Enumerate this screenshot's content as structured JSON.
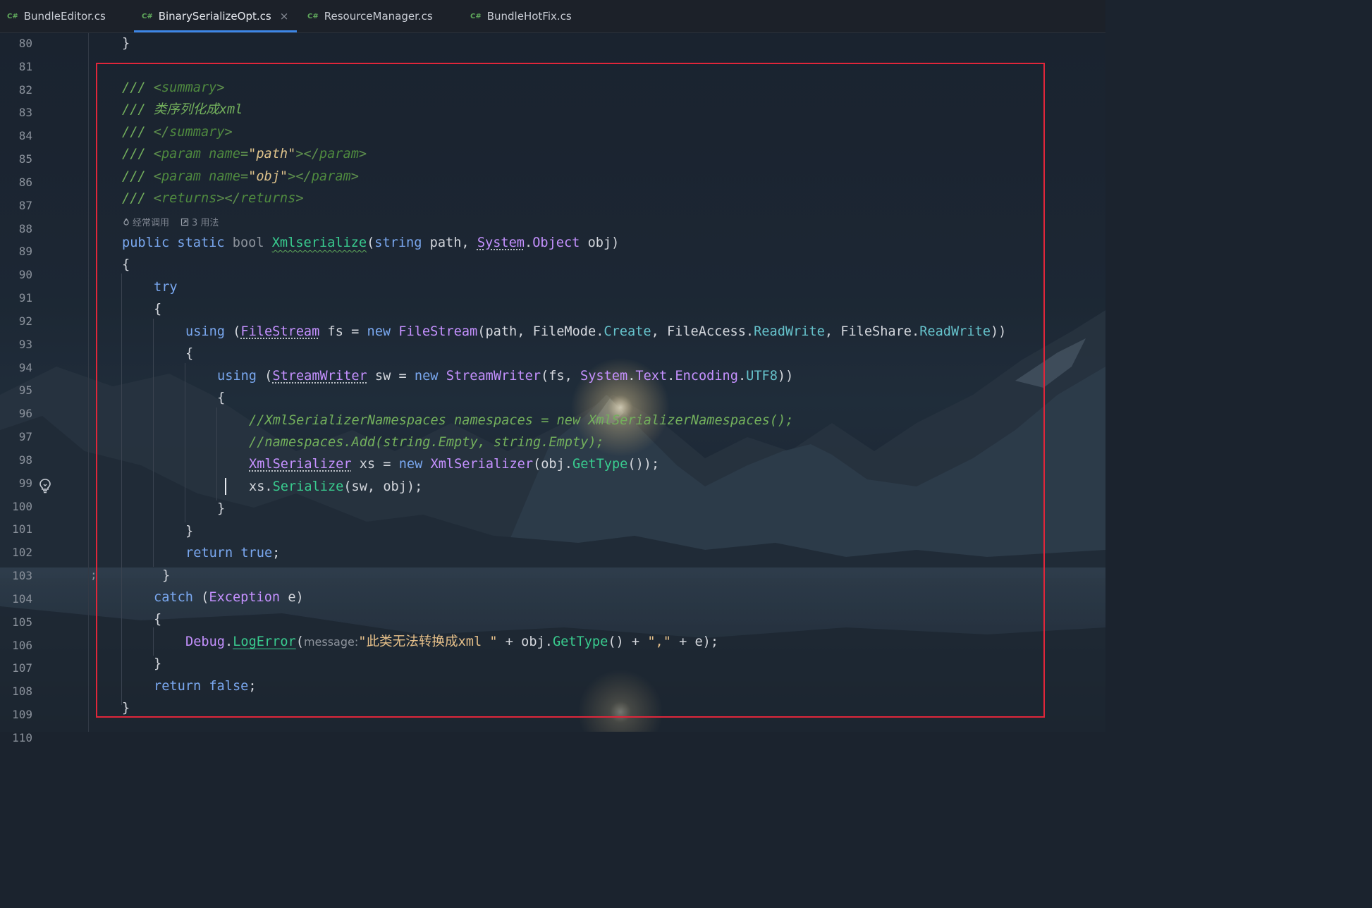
{
  "tabs": [
    {
      "lang": "C#",
      "label": "BundleEditor.cs"
    },
    {
      "lang": "C#",
      "label": "BinarySerializeOpt.cs",
      "close": "×"
    },
    {
      "lang": "C#",
      "label": "ResourceManager.cs"
    },
    {
      "lang": "C#",
      "label": "BundleHotFix.cs"
    }
  ],
  "line_numbers": [
    "80",
    "81",
    "82",
    "83",
    "84",
    "85",
    "86",
    "87",
    "88",
    "89",
    "90",
    "91",
    "92",
    "93",
    "94",
    "95",
    "96",
    "97",
    "98",
    "99",
    "100",
    "101",
    "102",
    "103",
    "104",
    "105",
    "106",
    "107",
    "108",
    "109",
    "110"
  ],
  "codelens": {
    "frequent": "经常调用",
    "usages": "3 用法"
  },
  "code": {
    "l80_brace": "}",
    "l82": {
      "slashes": "/// ",
      "lt": "<",
      "tag": "summary",
      "gt": ">"
    },
    "l83": {
      "slashes": "/// ",
      "text": "类序列化成xml"
    },
    "l84": {
      "slashes": "/// ",
      "lt": "</",
      "tag": "summary",
      "gt": ">"
    },
    "l85": {
      "slashes": "/// ",
      "lt": "<",
      "tag": "param",
      "attr": " name",
      "eq": "=",
      "val": "\"path\"",
      "mid": "></",
      "tag2": "param",
      "gt": ">"
    },
    "l86": {
      "slashes": "/// ",
      "lt": "<",
      "tag": "param",
      "attr": " name",
      "eq": "=",
      "val": "\"obj\"",
      "mid": "></",
      "tag2": "param",
      "gt": ">"
    },
    "l87": {
      "slashes": "/// ",
      "lt": "<",
      "tag": "returns",
      "mid": "></",
      "tag2": "returns",
      "gt": ">"
    },
    "l88": {
      "public": "public",
      "static": "static",
      "bool": "bool",
      "name": "Xmlserialize",
      "open": "(",
      "string": "string",
      "p1": " path, ",
      "system": "System",
      "dot": ".",
      "object": "Object",
      "p2": " obj)"
    },
    "l89": "{",
    "l90": "try",
    "l91": "{",
    "l92": {
      "using": "using",
      "open": " (",
      "fs_type": "FileStream",
      "decl": " fs = ",
      "new": "new",
      "ctor": "FileStream",
      "args1": "(path, ",
      "fm": "FileMode",
      "d1": ".",
      "create": "Create",
      "c1": ", ",
      "fa": "FileAccess",
      "d2": ".",
      "rw1": "ReadWrite",
      "c2": ", ",
      "fsh": "FileShare",
      "d3": ".",
      "rw2": "ReadWrite",
      "close": "))"
    },
    "l93": "{",
    "l94": {
      "using": "using",
      "open": " (",
      "sw_type": "StreamWriter",
      "decl": " sw = ",
      "new": "new",
      "ctor": "StreamWriter",
      "args1": "(fs, ",
      "system": "System",
      "d1": ".",
      "text": "Text",
      "d2": ".",
      "enc": "Encoding",
      "d3": ".",
      "utf8": "UTF8",
      "close": "))"
    },
    "l95": "{",
    "l96": "//XmlSerializerNamespaces namespaces = new XmlSerializerNamespaces();",
    "l97": "//namespaces.Add(string.Empty, string.Empty);",
    "l98": {
      "type": "XmlSerializer",
      "decl": " xs = ",
      "new": "new",
      "ctor": "XmlSerializer",
      "open": "(obj.",
      "gettype": "GetType",
      "close": "());"
    },
    "l99": {
      "pre": "xs.",
      "serialize": "Serialize",
      "args": "(sw, obj);"
    },
    "l100": "}",
    "l101": "}",
    "l102": {
      "return": "return",
      "true": " true",
      "semi": ";"
    },
    "l103": "}",
    "l104": {
      "catch": "catch",
      "open": " (",
      "exc": "Exception",
      "rest": " e)"
    },
    "l105": "{",
    "l106": {
      "debug": "Debug",
      "dot": ".",
      "logerror": "LogError",
      "open": "(",
      "hint": "message:",
      "str": "\"此类无法转换成xml \"",
      "plus1": " + obj.",
      "gettype": "GetType",
      "mid": "() + ",
      "str2": "\",\"",
      "end": " + e);"
    },
    "l107": "}",
    "l108": {
      "return": "return",
      "false": " false",
      "semi": ";"
    },
    "l109": "}"
  },
  "colors": {
    "highlight_box": "#e0263a",
    "active_tab_underline": "#3d86e6"
  }
}
